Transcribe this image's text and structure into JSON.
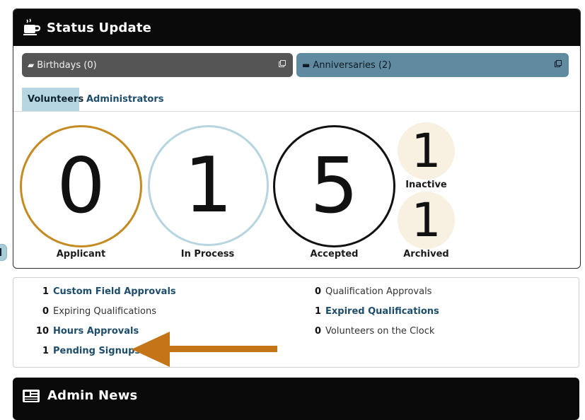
{
  "status_panel": {
    "title": "Status Update",
    "birthdays_label": "Birthdays (0)",
    "anniversaries_label": "Anniversaries (2)",
    "tabs": [
      "Volunteers",
      "Administrators"
    ],
    "active_tab": "Volunteers",
    "counts": {
      "applicant": {
        "value": "0",
        "label": "Applicant"
      },
      "in_process": {
        "value": "1",
        "label": "In Process"
      },
      "accepted": {
        "value": "5",
        "label": "Accepted"
      },
      "inactive": {
        "value": "1",
        "label": "Inactive"
      },
      "archived": {
        "value": "1",
        "label": "Archived"
      }
    }
  },
  "stats": {
    "left": [
      {
        "count": "1",
        "label": "Custom Field Approvals",
        "link": true
      },
      {
        "count": "0",
        "label": "Expiring Qualifications",
        "link": false
      },
      {
        "count": "10",
        "label": "Hours Approvals",
        "link": true
      },
      {
        "count": "1",
        "label": "Pending Signups",
        "link": true
      }
    ],
    "right": [
      {
        "count": "0",
        "label": "Qualification Approvals",
        "link": false
      },
      {
        "count": "1",
        "label": "Expired Qualifications",
        "link": true
      },
      {
        "count": "0",
        "label": "Volunteers on the Clock",
        "link": false
      }
    ]
  },
  "news_panel": {
    "title": "Admin News"
  },
  "colors": {
    "header_bg": "#0a0a0a",
    "applicant_ring": "#c58b22",
    "in_process_ring": "#b7d5df",
    "accepted_ring": "#111111",
    "small_circle_bg": "#f8f0e0",
    "anniversaries_bg": "#5f8aa0",
    "birthdays_bg": "#555555",
    "link": "#1e4d6b",
    "arrow": "#c47518"
  },
  "icons": {
    "header": "coffee-cup-icon",
    "birthdays": "cake-icon",
    "anniversaries": "scroll-icon",
    "external": "external-link-icon",
    "news": "newspaper-icon"
  }
}
